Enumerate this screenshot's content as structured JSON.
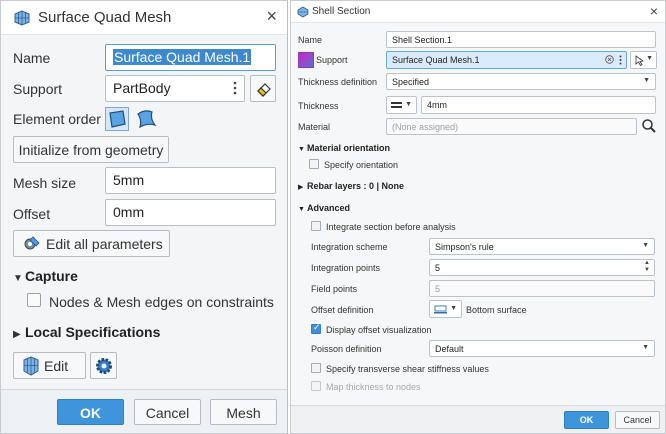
{
  "left_dialog": {
    "title": "Surface Quad Mesh",
    "close_symbol": "×",
    "name_label": "Name",
    "name_value": "Surface Quad Mesh.1",
    "support_label": "Support",
    "support_value": "PartBody",
    "element_order_label": "Element order",
    "initialize_button": "Initialize from geometry",
    "mesh_size_label": "Mesh size",
    "mesh_size_value": "5mm",
    "offset_label": "Offset",
    "offset_value": "0mm",
    "edit_all_button": "Edit all parameters",
    "capture_section": "Capture",
    "nodes_checkbox_label": "Nodes & Mesh edges on constraints",
    "local_spec_section": "Local Specifications",
    "edit_button": "Edit",
    "footer": {
      "ok": "OK",
      "cancel": "Cancel",
      "mesh": "Mesh"
    },
    "icons": [
      "mesh-icon",
      "vertical-dots-icon",
      "eraser-icon",
      "linear-element-icon",
      "quadratic-element-icon",
      "edit-parameters-icon",
      "edit-mesh-icon",
      "gear-icon"
    ],
    "accent_color": "#3e95dc"
  },
  "right_dialog": {
    "title": "Shell Section",
    "close_symbol": "×",
    "name_label": "Name",
    "name_value": "Shell Section.1",
    "support_label": "Support",
    "support_value": "Surface Quad Mesh.1",
    "thickness_def_label": "Thickness definition",
    "thickness_def_value": "Specified",
    "thickness_label": "Thickness",
    "thickness_value": "4mm",
    "material_label": "Material",
    "material_placeholder": "(None assigned)",
    "material_orientation_section": "Material orientation",
    "specify_orientation_label": "Specify orientation",
    "rebar_section": "Rebar layers : 0 | None",
    "advanced_section": "Advanced",
    "integrate_label": "Integrate section before analysis",
    "integration_scheme_label": "Integration scheme",
    "integration_scheme_value": "Simpson's rule",
    "integration_points_label": "Integration points",
    "integration_points_value": "5",
    "field_points_label": "Field points",
    "field_points_value": "5",
    "offset_def_label": "Offset definition",
    "offset_def_value": "Bottom surface",
    "display_offset_label": "Display offset visualization",
    "display_offset_checked": true,
    "poisson_label": "Poisson definition",
    "poisson_value": "Default",
    "shear_label": "Specify transverse shear stiffness values",
    "map_thickness_label": "Map thickness to nodes",
    "footer": {
      "ok": "OK",
      "cancel": "Cancel"
    },
    "icons": [
      "shell-section-icon",
      "support-color-swatch-icon",
      "clear-icon",
      "vertical-dots-icon",
      "cursor-select-icon",
      "thickness-type-icon",
      "search-icon",
      "offset-surface-icon",
      "spinner-up-icon",
      "spinner-down-icon"
    ],
    "accent_color": "#3f8fd6"
  }
}
